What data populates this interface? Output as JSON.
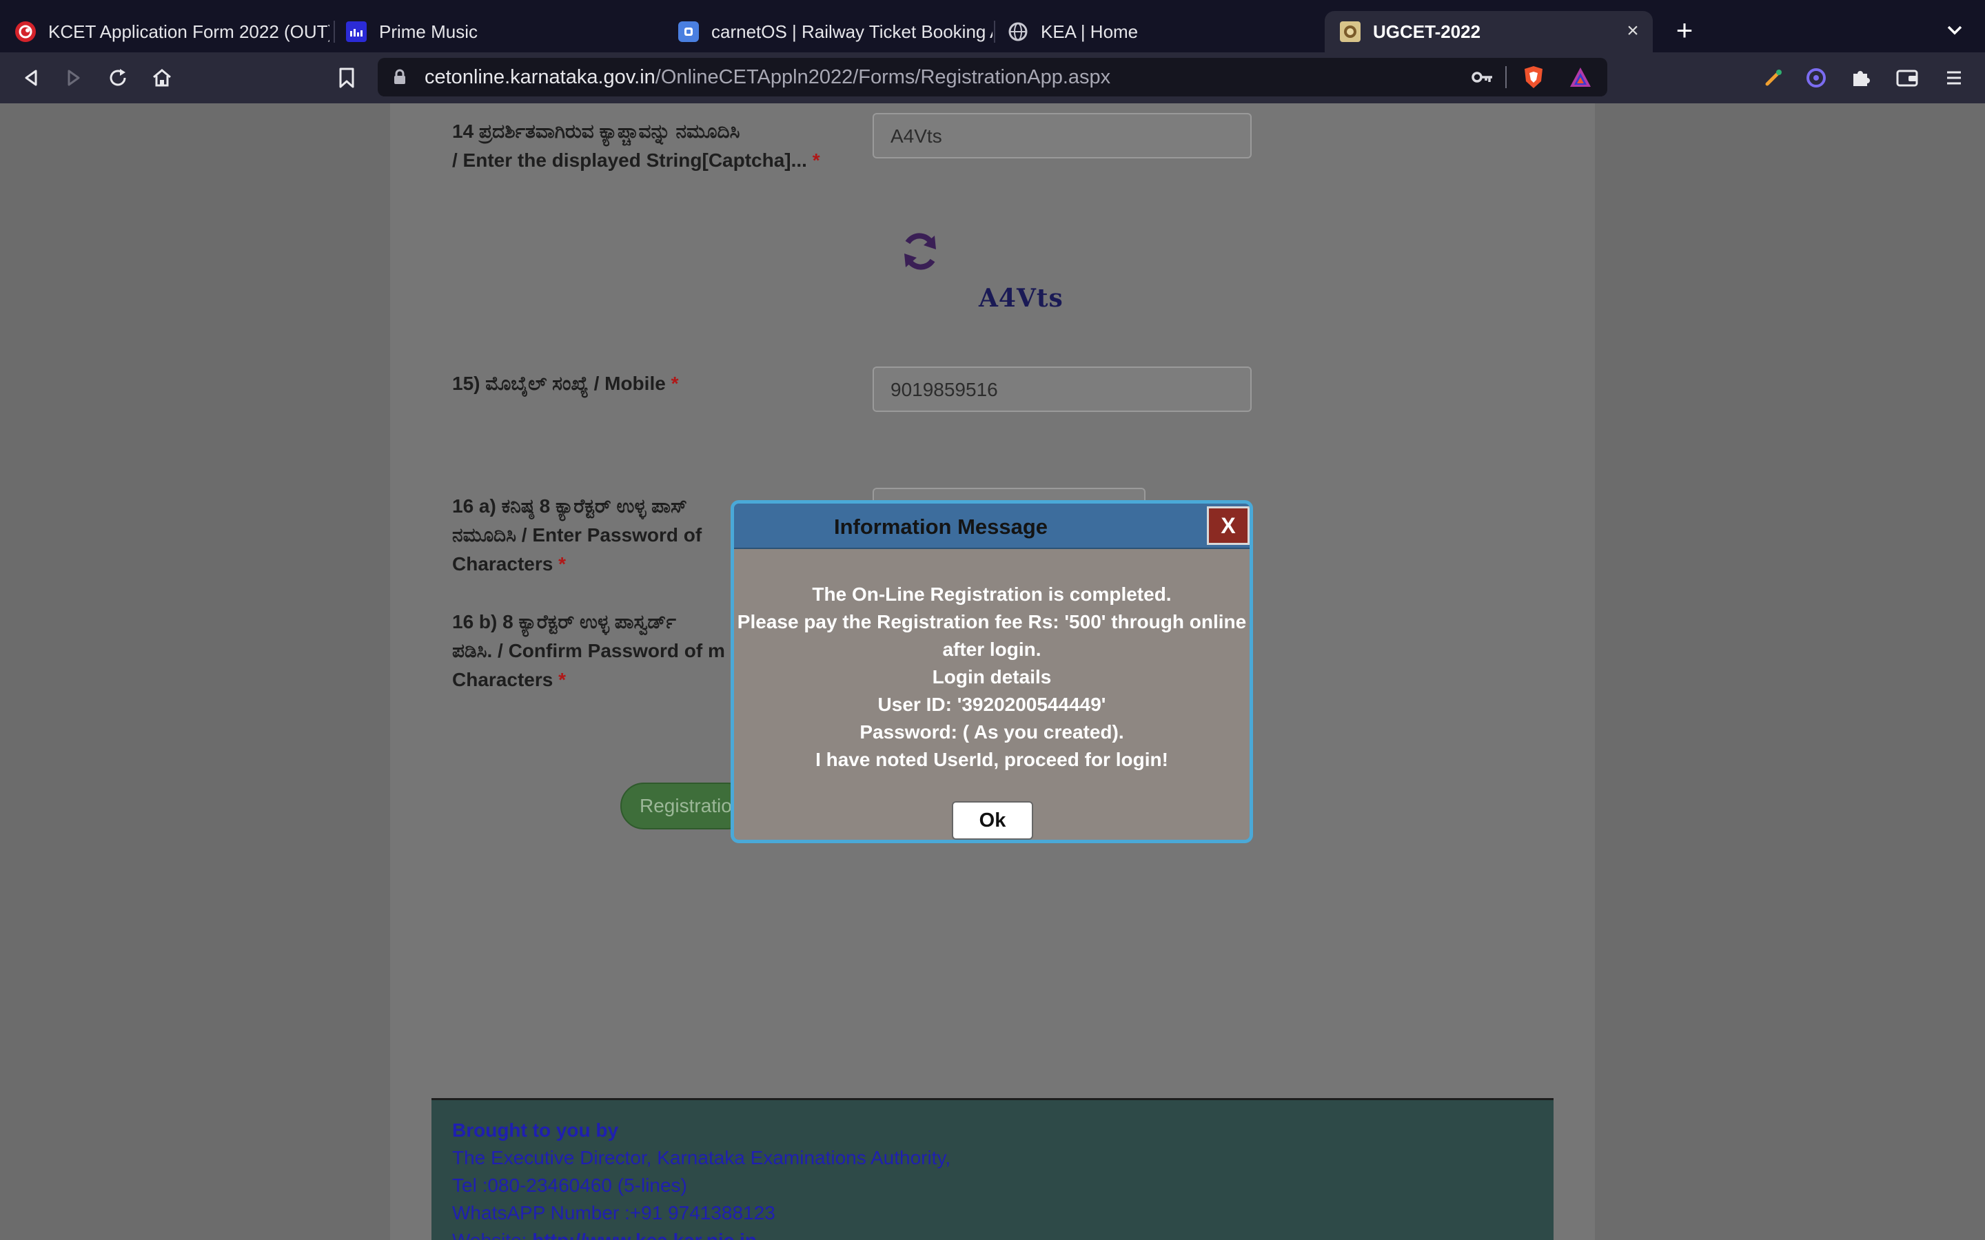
{
  "browser": {
    "tabs": [
      {
        "title": "KCET Application Form 2022 (OUT)",
        "icon": "kcet-logo-icon",
        "active": false
      },
      {
        "title": "Prime Music",
        "icon": "prime-music-icon",
        "active": false
      },
      {
        "title": "carnetOS | Railway Ticket Booking A",
        "icon": "carnetos-icon",
        "active": false
      },
      {
        "title": "KEA | Home",
        "icon": "globe-icon",
        "active": false
      },
      {
        "title": "UGCET-2022",
        "icon": "kea-emblem-icon",
        "active": true
      }
    ],
    "url": {
      "domain": "cetonline.karnataka.gov.in",
      "path": "/OnlineCETAppln2022/Forms/RegistrationApp.aspx"
    }
  },
  "form": {
    "captcha_label_line1": "14 ಪ್ರದರ್ಶಿತವಾಗಿರುವ ಕ್ಯಾಪ್ಚಾವನ್ನು ನಮೂದಿಸಿ",
    "captcha_label_line2": "/ Enter the displayed String[Captcha]...",
    "captcha_value": "A4Vts",
    "captcha_image_text": "A4Vts",
    "mobile_label": "15) ಮೊಬೈಲ್ ಸಂಖ್ಯೆ / Mobile",
    "mobile_value": "9019859516",
    "password_label_line1": "16 a) ಕನಿಷ್ಠ 8 ಕ್ಯಾರೆಕ್ಟರ್ ಉಳ್ಳ ಪಾಸ್",
    "password_label_line2": "ನಮೂದಿಸಿ / Enter Password of",
    "password_label_line3": "Characters",
    "confirm_label_line1": "16 b) 8 ಕ್ಯಾರೆಕ್ಟರ್ ಉಳ್ಳ ಪಾಸ್ವರ್ಡ್",
    "confirm_label_line2": "ಪಡಿಸಿ. / Confirm Password of m",
    "confirm_label_line3": "Characters",
    "required_mark": "*",
    "register_button": "Registratio"
  },
  "footer": {
    "heading": "Brought to you by",
    "line1": "The Executive Director, Karnataka Examinations Authority,",
    "line2": "Tel :080-23460460 (5-lines)",
    "line3": "WhatsAPP Number :+91 9741388123",
    "website_label": "Website:",
    "website_link": "http://www.kea.kar.nic.in"
  },
  "modal": {
    "title": "Information Message",
    "close_label": "X",
    "lines": [
      "The On-Line Registration is completed.",
      "Please pay the Registration fee Rs: '500' through online",
      "after login.",
      "Login details",
      "User ID: '3920200544449'",
      "Password: ( As you created).",
      "I have noted UserId, proceed for login!"
    ],
    "ok_label": "Ok"
  },
  "colors": {
    "tabstrip": "#131325",
    "toolbar": "#2a2a3a",
    "modal_border": "#4aa9d8",
    "modal_header": "#3d6d9d",
    "modal_close": "#8b2a22",
    "register_button": "#3e6e3a",
    "footer_bg": "#2e4a48",
    "footer_text": "#1f1fb0"
  }
}
